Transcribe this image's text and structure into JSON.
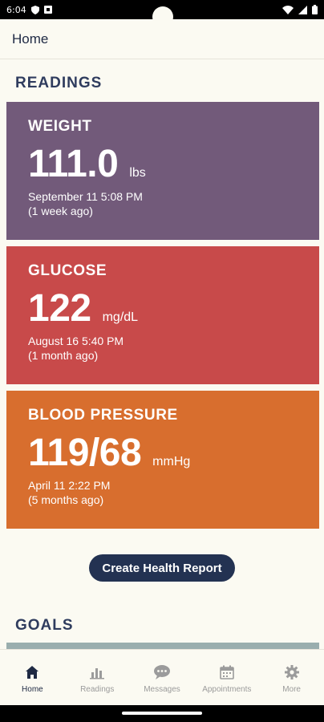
{
  "status": {
    "time": "6:04"
  },
  "appbar": {
    "title": "Home"
  },
  "readings": {
    "section_title": "READINGS",
    "cards": [
      {
        "label": "WEIGHT",
        "value": "111.0",
        "unit": "lbs",
        "date": "September 11  5:08 PM",
        "ago": "(1 week ago)",
        "color": "#725a7a"
      },
      {
        "label": "GLUCOSE",
        "value": "122",
        "unit": "mg/dL",
        "date": "August 16  5:40 PM",
        "ago": "(1 month ago)",
        "color": "#c84a4a"
      },
      {
        "label": "BLOOD PRESSURE",
        "value": "119/68",
        "unit": "mmHg",
        "date": "April 11  2:22 PM",
        "ago": "(5 months ago)",
        "color": "#d86e2e"
      }
    ]
  },
  "report_button": {
    "label": "Create Health Report"
  },
  "goals": {
    "section_title": "GOALS"
  },
  "nav": {
    "items": [
      {
        "label": "Home",
        "icon": "home-icon"
      },
      {
        "label": "Readings",
        "icon": "bar-chart-icon"
      },
      {
        "label": "Messages",
        "icon": "chat-bubble-icon"
      },
      {
        "label": "Appointments",
        "icon": "calendar-icon"
      },
      {
        "label": "More",
        "icon": "gear-icon"
      }
    ]
  }
}
